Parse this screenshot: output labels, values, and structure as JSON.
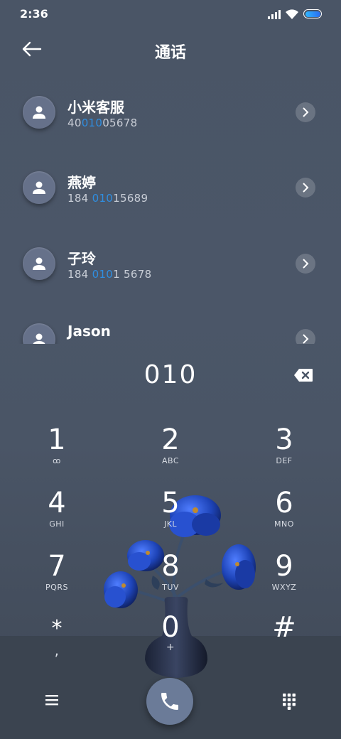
{
  "status_bar": {
    "time": "2:36"
  },
  "header": {
    "title": "通话"
  },
  "contacts": [
    {
      "name": "小米客服",
      "number_pre": "40",
      "number_hl": "010",
      "number_post": "05678"
    },
    {
      "name": "燕婷",
      "number_pre": "184 ",
      "number_hl": "010",
      "number_post": "15689"
    },
    {
      "name": "子玲",
      "number_pre": "184 ",
      "number_hl": "010",
      "number_post": "1 5678"
    },
    {
      "name": "Jason",
      "number_pre": "",
      "number_hl": "",
      "number_post": ""
    }
  ],
  "dialer": {
    "input": "010"
  },
  "keypad": [
    {
      "digit": "1",
      "letters": "ꝏ"
    },
    {
      "digit": "2",
      "letters": "ABC"
    },
    {
      "digit": "3",
      "letters": "DEF"
    },
    {
      "digit": "4",
      "letters": "GHI"
    },
    {
      "digit": "5",
      "letters": "JKL"
    },
    {
      "digit": "6",
      "letters": "MNO"
    },
    {
      "digit": "7",
      "letters": "PQRS"
    },
    {
      "digit": "8",
      "letters": "TUV"
    },
    {
      "digit": "9",
      "letters": "WXYZ"
    },
    {
      "digit": "*",
      "letters": ","
    },
    {
      "digit": "0",
      "letters": "+"
    },
    {
      "digit": "#",
      "letters": ""
    }
  ],
  "colors": {
    "accent": "#2f8ee0",
    "background": "#4a5566",
    "call_button": "#6b7b98"
  },
  "icons": [
    "back-arrow-icon",
    "person-icon",
    "chevron-right-icon",
    "backspace-icon",
    "menu-icon",
    "phone-icon",
    "dialpad-icon"
  ]
}
